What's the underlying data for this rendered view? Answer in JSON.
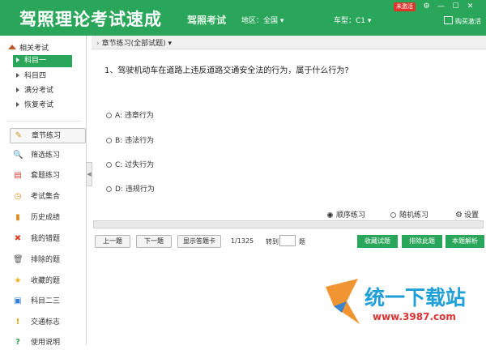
{
  "app": {
    "title": "驾照理论考试速成",
    "subtitle": "驾照考试",
    "region": "地区：全国 ▾",
    "cartype": "车型：C1 ▾",
    "badge": "未激活",
    "buy_label": "购买激活",
    "window_buttons": [
      "⚙",
      "—",
      "☐",
      "✕"
    ]
  },
  "sidebar": {
    "section_title": "相关考试",
    "subjects": [
      {
        "label": "科目一",
        "active": true
      },
      {
        "label": "科目四",
        "active": false
      },
      {
        "label": "满分考试",
        "active": false
      },
      {
        "label": "恢复考试",
        "active": false
      }
    ],
    "nav": [
      {
        "label": "章节练习",
        "icon": "pencil-icon",
        "glyph": "✎",
        "color": "#c79a2a",
        "selected": true
      },
      {
        "label": "筛选练习",
        "icon": "magnifier-icon",
        "glyph": "🔍",
        "color": "#4a7bc4"
      },
      {
        "label": "套题练习",
        "icon": "book-icon",
        "glyph": "▤",
        "color": "#d0413a"
      },
      {
        "label": "考试集合",
        "icon": "clock-icon",
        "glyph": "◷",
        "color": "#e08a1c"
      },
      {
        "label": "历史成绩",
        "icon": "bar-chart-icon",
        "glyph": "▮",
        "color": "#e08a1c"
      },
      {
        "label": "我的错题",
        "icon": "x-mark-icon",
        "glyph": "✖",
        "color": "#d9432b"
      },
      {
        "label": "排除的题",
        "icon": "trash-icon",
        "glyph": "🗑",
        "color": "#555"
      },
      {
        "label": "收藏的题",
        "icon": "star-icon",
        "glyph": "★",
        "color": "#f0b020"
      },
      {
        "label": "科目二三",
        "icon": "document-icon",
        "glyph": "▣",
        "color": "#2f7ed8"
      },
      {
        "label": "交通标志",
        "icon": "warning-sign-icon",
        "glyph": "!",
        "color": "#e0a400"
      },
      {
        "label": "使用说明",
        "icon": "help-icon",
        "glyph": "?",
        "color": "#2aa65a"
      }
    ]
  },
  "main": {
    "breadcrumb": "章节练习(全部试题) ▾",
    "question": "1、驾驶机动车在道路上违反道路交通安全法的行为，属于什么行为?",
    "options": [
      "A: 违章行为",
      "B: 违法行为",
      "C: 过失行为",
      "D: 违规行为"
    ],
    "mode_sequential": "顺序练习",
    "mode_random": "随机练习",
    "settings": "设置",
    "buttons": {
      "prev": "上一题",
      "next": "下一题",
      "show_answer": "显示答题卡",
      "counter": "1/1325",
      "jump_to": "转到",
      "question_unit": "题",
      "collect": "收藏试题",
      "exclude": "排除此题",
      "explain": "本题解析"
    }
  },
  "watermark": {
    "text": "统一下载站",
    "url": "www.3987.com"
  }
}
